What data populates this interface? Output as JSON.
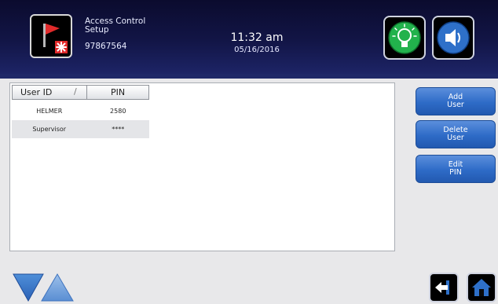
{
  "header": {
    "title_line1": "Access Control",
    "title_line2": "Setup",
    "serial": "97867564",
    "time": "11:32 am",
    "date": "05/16/2016",
    "icons": {
      "logo": "red-flag-alarm-icon",
      "light": "lightbulb-icon",
      "sound": "speaker-mute-icon"
    }
  },
  "table": {
    "columns": [
      "User ID",
      "PIN"
    ],
    "sort_indicator": "/",
    "rows": [
      {
        "user_id": "HELMER",
        "pin": "2580"
      },
      {
        "user_id": "Supervisor",
        "pin": "****"
      }
    ]
  },
  "buttons": {
    "add": {
      "line1": "Add",
      "line2": "User"
    },
    "delete": {
      "line1": "Delete",
      "line2": "User"
    },
    "edit": {
      "line1": "Edit",
      "line2": "PIN"
    }
  },
  "footer_icons": {
    "scroll_down": "scroll-down-icon",
    "scroll_up": "scroll-up-icon",
    "back": "back-arrow-icon",
    "home": "home-icon"
  },
  "colors": {
    "header_bg": "#121546",
    "button_blue": "#2e6bc7",
    "flag_red": "#e02a2a",
    "bulb_green": "#22b24c",
    "speaker_blue": "#2e70c9"
  }
}
